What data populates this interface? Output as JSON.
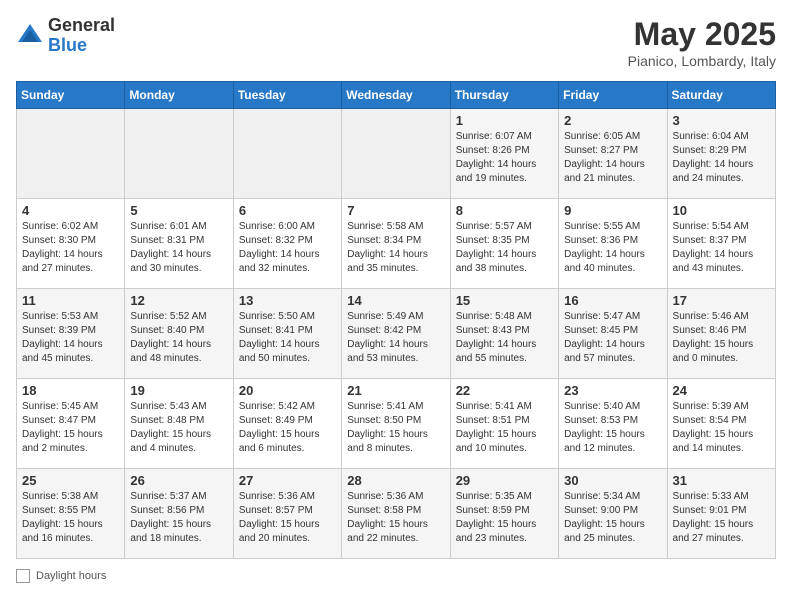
{
  "header": {
    "logo_general": "General",
    "logo_blue": "Blue",
    "month_title": "May 2025",
    "location": "Pianico, Lombardy, Italy"
  },
  "days_of_week": [
    "Sunday",
    "Monday",
    "Tuesday",
    "Wednesday",
    "Thursday",
    "Friday",
    "Saturday"
  ],
  "weeks": [
    [
      {
        "day": "",
        "info": ""
      },
      {
        "day": "",
        "info": ""
      },
      {
        "day": "",
        "info": ""
      },
      {
        "day": "",
        "info": ""
      },
      {
        "day": "1",
        "info": "Sunrise: 6:07 AM\nSunset: 8:26 PM\nDaylight: 14 hours\nand 19 minutes."
      },
      {
        "day": "2",
        "info": "Sunrise: 6:05 AM\nSunset: 8:27 PM\nDaylight: 14 hours\nand 21 minutes."
      },
      {
        "day": "3",
        "info": "Sunrise: 6:04 AM\nSunset: 8:29 PM\nDaylight: 14 hours\nand 24 minutes."
      }
    ],
    [
      {
        "day": "4",
        "info": "Sunrise: 6:02 AM\nSunset: 8:30 PM\nDaylight: 14 hours\nand 27 minutes."
      },
      {
        "day": "5",
        "info": "Sunrise: 6:01 AM\nSunset: 8:31 PM\nDaylight: 14 hours\nand 30 minutes."
      },
      {
        "day": "6",
        "info": "Sunrise: 6:00 AM\nSunset: 8:32 PM\nDaylight: 14 hours\nand 32 minutes."
      },
      {
        "day": "7",
        "info": "Sunrise: 5:58 AM\nSunset: 8:34 PM\nDaylight: 14 hours\nand 35 minutes."
      },
      {
        "day": "8",
        "info": "Sunrise: 5:57 AM\nSunset: 8:35 PM\nDaylight: 14 hours\nand 38 minutes."
      },
      {
        "day": "9",
        "info": "Sunrise: 5:55 AM\nSunset: 8:36 PM\nDaylight: 14 hours\nand 40 minutes."
      },
      {
        "day": "10",
        "info": "Sunrise: 5:54 AM\nSunset: 8:37 PM\nDaylight: 14 hours\nand 43 minutes."
      }
    ],
    [
      {
        "day": "11",
        "info": "Sunrise: 5:53 AM\nSunset: 8:39 PM\nDaylight: 14 hours\nand 45 minutes."
      },
      {
        "day": "12",
        "info": "Sunrise: 5:52 AM\nSunset: 8:40 PM\nDaylight: 14 hours\nand 48 minutes."
      },
      {
        "day": "13",
        "info": "Sunrise: 5:50 AM\nSunset: 8:41 PM\nDaylight: 14 hours\nand 50 minutes."
      },
      {
        "day": "14",
        "info": "Sunrise: 5:49 AM\nSunset: 8:42 PM\nDaylight: 14 hours\nand 53 minutes."
      },
      {
        "day": "15",
        "info": "Sunrise: 5:48 AM\nSunset: 8:43 PM\nDaylight: 14 hours\nand 55 minutes."
      },
      {
        "day": "16",
        "info": "Sunrise: 5:47 AM\nSunset: 8:45 PM\nDaylight: 14 hours\nand 57 minutes."
      },
      {
        "day": "17",
        "info": "Sunrise: 5:46 AM\nSunset: 8:46 PM\nDaylight: 15 hours\nand 0 minutes."
      }
    ],
    [
      {
        "day": "18",
        "info": "Sunrise: 5:45 AM\nSunset: 8:47 PM\nDaylight: 15 hours\nand 2 minutes."
      },
      {
        "day": "19",
        "info": "Sunrise: 5:43 AM\nSunset: 8:48 PM\nDaylight: 15 hours\nand 4 minutes."
      },
      {
        "day": "20",
        "info": "Sunrise: 5:42 AM\nSunset: 8:49 PM\nDaylight: 15 hours\nand 6 minutes."
      },
      {
        "day": "21",
        "info": "Sunrise: 5:41 AM\nSunset: 8:50 PM\nDaylight: 15 hours\nand 8 minutes."
      },
      {
        "day": "22",
        "info": "Sunrise: 5:41 AM\nSunset: 8:51 PM\nDaylight: 15 hours\nand 10 minutes."
      },
      {
        "day": "23",
        "info": "Sunrise: 5:40 AM\nSunset: 8:53 PM\nDaylight: 15 hours\nand 12 minutes."
      },
      {
        "day": "24",
        "info": "Sunrise: 5:39 AM\nSunset: 8:54 PM\nDaylight: 15 hours\nand 14 minutes."
      }
    ],
    [
      {
        "day": "25",
        "info": "Sunrise: 5:38 AM\nSunset: 8:55 PM\nDaylight: 15 hours\nand 16 minutes."
      },
      {
        "day": "26",
        "info": "Sunrise: 5:37 AM\nSunset: 8:56 PM\nDaylight: 15 hours\nand 18 minutes."
      },
      {
        "day": "27",
        "info": "Sunrise: 5:36 AM\nSunset: 8:57 PM\nDaylight: 15 hours\nand 20 minutes."
      },
      {
        "day": "28",
        "info": "Sunrise: 5:36 AM\nSunset: 8:58 PM\nDaylight: 15 hours\nand 22 minutes."
      },
      {
        "day": "29",
        "info": "Sunrise: 5:35 AM\nSunset: 8:59 PM\nDaylight: 15 hours\nand 23 minutes."
      },
      {
        "day": "30",
        "info": "Sunrise: 5:34 AM\nSunset: 9:00 PM\nDaylight: 15 hours\nand 25 minutes."
      },
      {
        "day": "31",
        "info": "Sunrise: 5:33 AM\nSunset: 9:01 PM\nDaylight: 15 hours\nand 27 minutes."
      }
    ]
  ],
  "footer": {
    "daylight_label": "Daylight hours"
  }
}
